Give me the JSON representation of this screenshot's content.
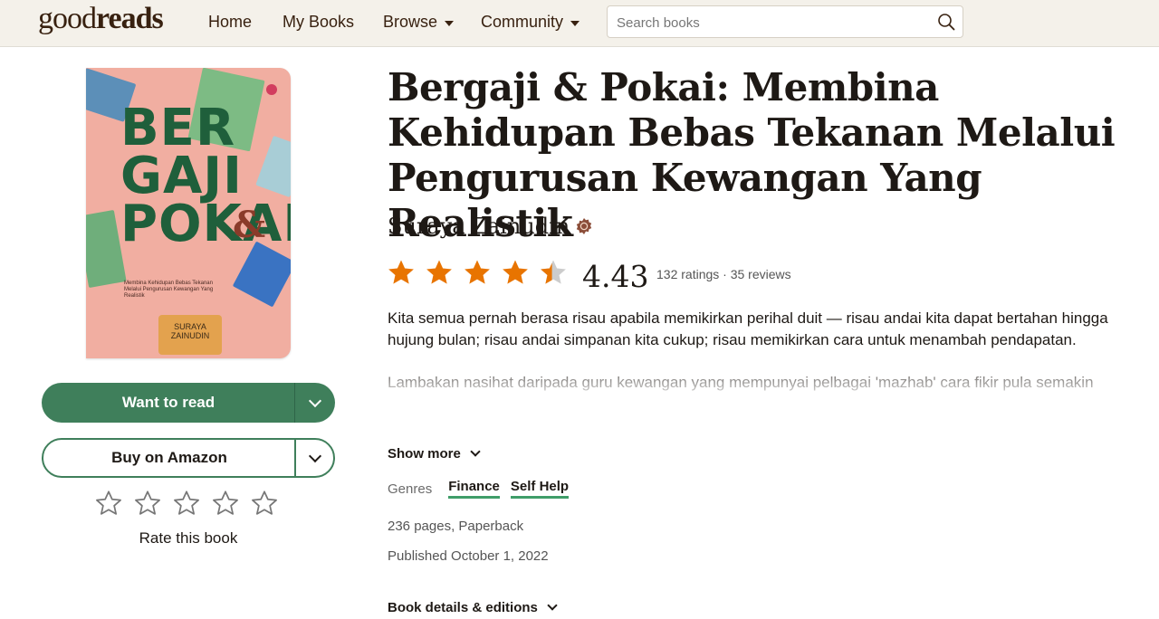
{
  "header": {
    "logo_thin": "good",
    "logo_bold": "reads",
    "nav": [
      {
        "label": "Home"
      },
      {
        "label": "My Books"
      },
      {
        "label": "Browse"
      },
      {
        "label": "Community"
      }
    ],
    "search_placeholder": "Search books"
  },
  "cover": {
    "title_lines": [
      "BER",
      "GAJI",
      "POKAI"
    ],
    "amp": "&",
    "subtitle": "Membina Kehidupan Bebas Tekanan Melalui Pengurusan Kewangan Yang Realistik",
    "author_line1": "SURAYA",
    "author_line2": "ZAINUDIN"
  },
  "actions": {
    "want_label": "Want to read",
    "amazon_label": "Buy on Amazon",
    "rate_label": "Rate this book"
  },
  "book": {
    "title": "Bergaji & Pokai: Membina Kehidupan Bebas Tekanan Melalui Pengurusan Kewangan Yang Realistik",
    "author": "Suraya Zainudin",
    "rating": "4.43",
    "rating_fraction": 0.886,
    "counts": "132 ratings · 35 reviews",
    "description": [
      "Kita semua pernah berasa risau apabila memikirkan perihal duit — risau andai kita dapat bertahan hingga hujung bulan; risau andai simpanan kita cukup; risau memikirkan cara untuk menambah pendapatan.",
      "Lambakan nasihat daripada guru kewangan yang mempunyai pelbagai 'mazhab' cara fikir pula semakin mengelirukan. Yang mana satu perlu didahulukan? Melabur, menabung, atau mencari kerja"
    ],
    "show_more": "Show more",
    "genres_label": "Genres",
    "genres": [
      "Finance",
      "Self Help"
    ],
    "pages": "236 pages, Paperback",
    "published": "Published October 1, 2022",
    "details": "Book details & editions"
  },
  "colors": {
    "star_filled": "#e87400",
    "star_empty": "#cccccc",
    "button_green": "#3f7f5b",
    "genre_underline": "#409d69"
  }
}
